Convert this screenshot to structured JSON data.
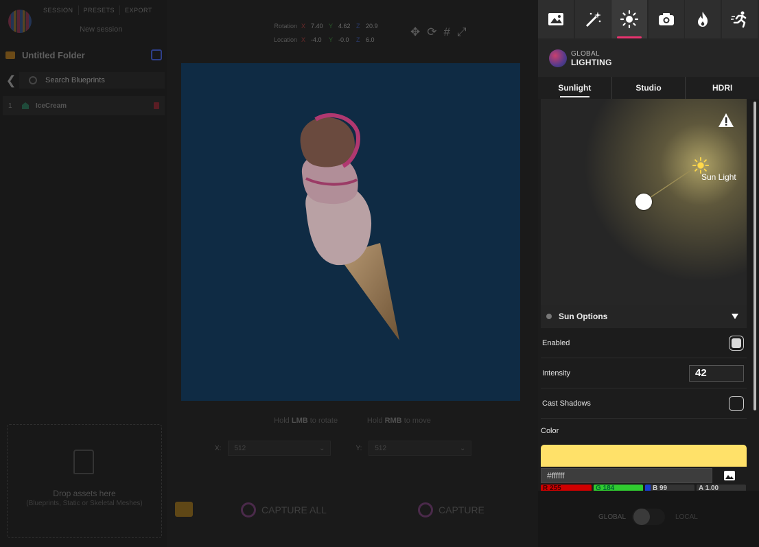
{
  "app": {
    "menu": [
      "SESSION",
      "PRESETS",
      "EXPORT"
    ],
    "session_name": "New session"
  },
  "left": {
    "folder_title": "Untitled Folder",
    "search_placeholder": "Search Blueprints",
    "items": [
      {
        "index": "1",
        "name": "IceCream"
      }
    ],
    "drop_title": "Drop assets here",
    "drop_sub": "(Blueprints, Static or Skeletal Meshes)"
  },
  "viewport": {
    "rotation_label": "Rotation",
    "location_label": "Location",
    "rotation": {
      "x": "7.40",
      "y": "4.62",
      "z": "20.9"
    },
    "location": {
      "x": "-4.0",
      "y": "-0.0",
      "z": "6.0"
    },
    "hint_hold1": "Hold",
    "hint_lmb": "LMB",
    "hint_rotate": "to rotate",
    "hint_hold2": "Hold",
    "hint_rmb": "RMB",
    "hint_move": "to move",
    "res_x_label": "X:",
    "res_x": "512",
    "res_y_label": "Y:",
    "res_y": "512",
    "capture_all": "CAPTURE ALL",
    "capture": "CAPTURE"
  },
  "panel": {
    "tabs": [
      "image-icon",
      "magic-wand-icon",
      "sun-icon",
      "camera-icon",
      "fire-icon",
      "running-icon"
    ],
    "active_tab": 2,
    "section_line1": "GLOBAL",
    "section_line2": "LIGHTING",
    "subtabs": [
      "Sunlight",
      "Studio",
      "HDRI"
    ],
    "sun_label": "Sun Light",
    "options_title": "Sun Options",
    "enabled_label": "Enabled",
    "enabled": true,
    "intensity_label": "Intensity",
    "intensity": "42",
    "cast_shadows_label": "Cast Shadows",
    "cast_shadows": false,
    "color_label": "Color",
    "color_swatch": "#ffe169",
    "hex_value": "#ffffff",
    "channels": {
      "r": "R 255",
      "g": "G 184",
      "b": "B 99",
      "a": "A 1.00"
    }
  },
  "mode": {
    "global": "GLOBAL",
    "local": "LOCAL"
  },
  "colors": {
    "accent": "#e8336f",
    "canvas_bg": "#0f2b44"
  }
}
